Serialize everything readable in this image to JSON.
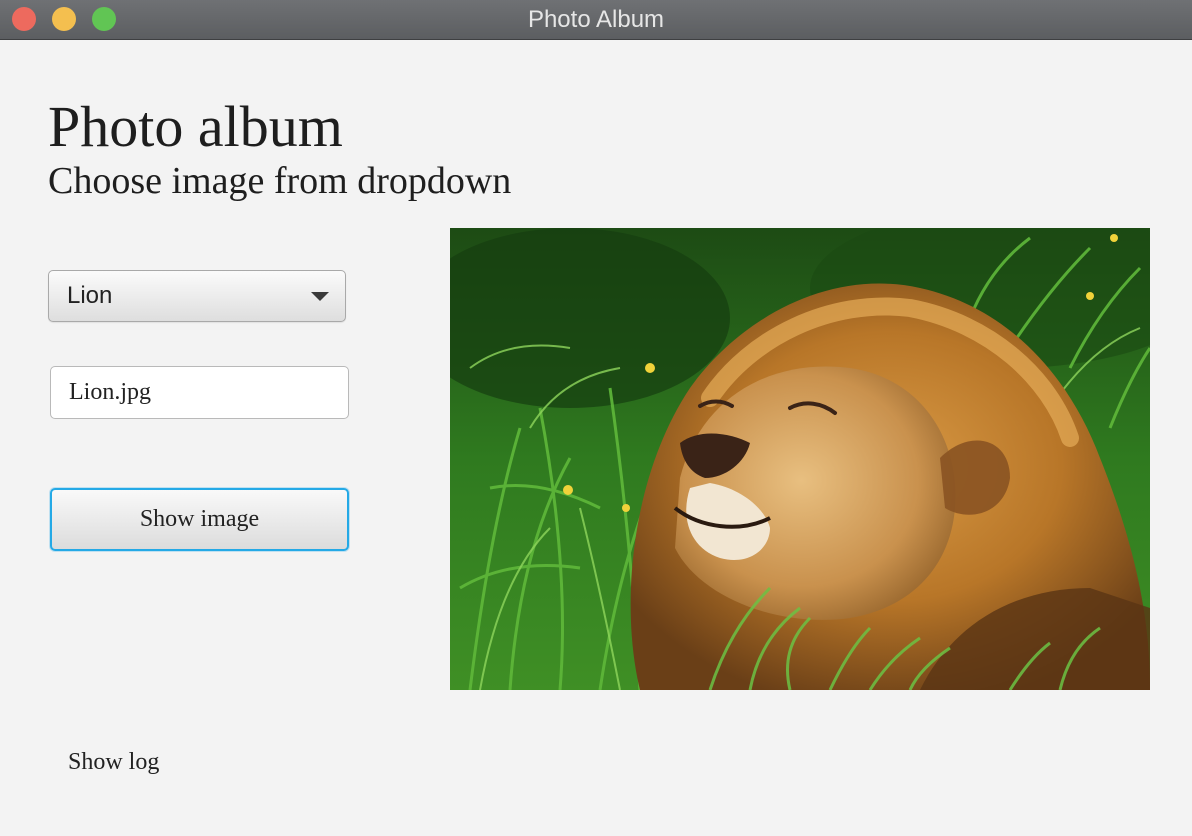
{
  "window": {
    "title": "Photo Album"
  },
  "header": {
    "title": "Photo album",
    "subtitle": "Choose image from dropdown"
  },
  "controls": {
    "image_select": {
      "selected": "Lion"
    },
    "filename_field": {
      "value": "Lion.jpg"
    },
    "show_image_button": {
      "label": "Show image"
    },
    "show_log_link": {
      "label": "Show log"
    }
  },
  "photo": {
    "subject": "lion-photo"
  },
  "icons": {
    "dropdown": "chevron-down-icon"
  },
  "colors": {
    "window_background": "#f3f3f3",
    "focus_ring": "#24a9e6",
    "traffic_close": "#ed6a5e",
    "traffic_minimize": "#f4bf4f",
    "traffic_zoom": "#61c554"
  }
}
